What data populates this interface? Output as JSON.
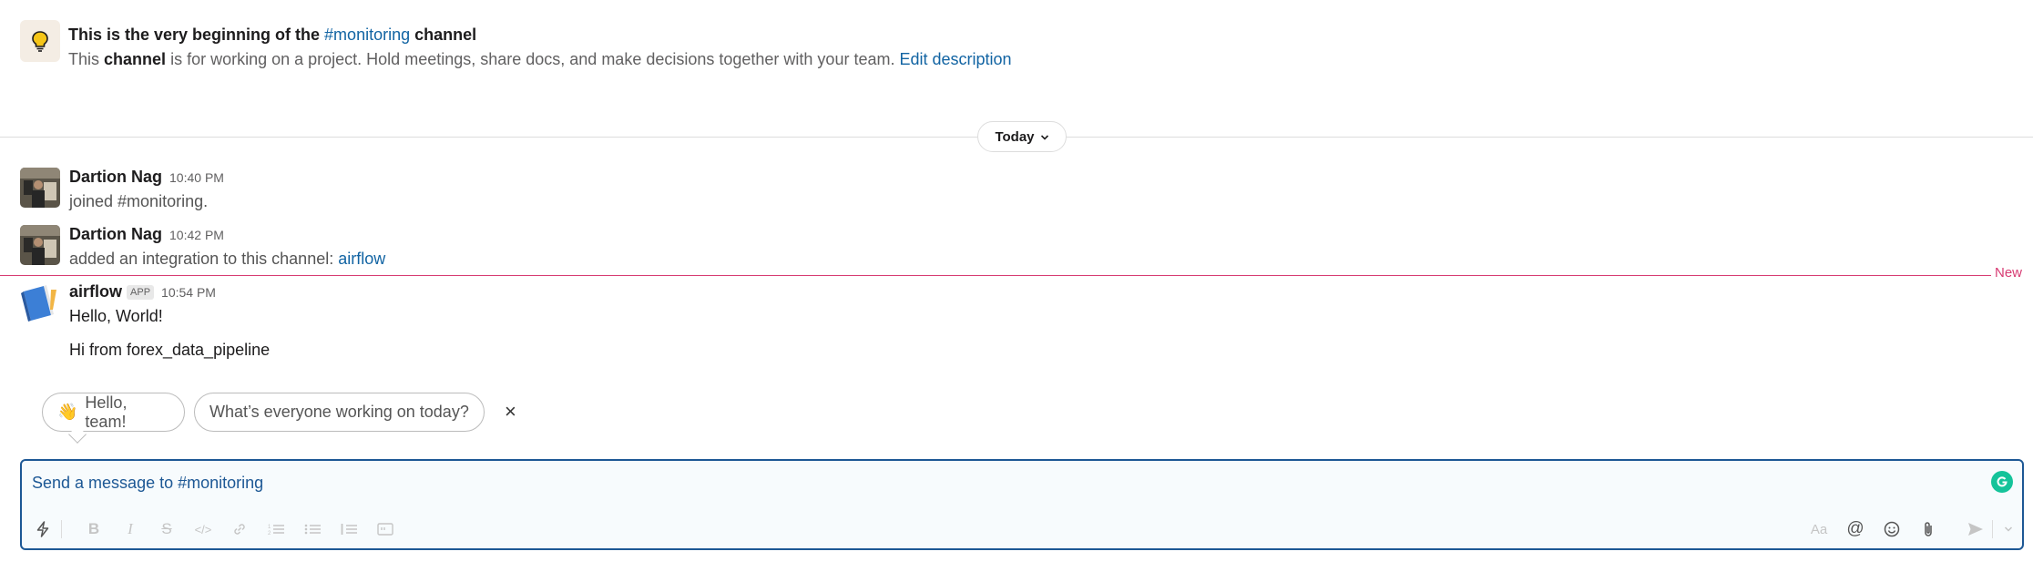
{
  "intro": {
    "title_prefix": "This is the very beginning of the",
    "channel": "#monitoring",
    "title_suffix": "channel",
    "desc_pre": "This",
    "desc_bold": "channel",
    "desc_post": "is for working on a project. Hold meetings, share docs, and make decisions together with your team.",
    "edit_link": "Edit description"
  },
  "divider": {
    "label": "Today"
  },
  "messages": [
    {
      "author": "Dartion Nag",
      "time": "10:40 PM",
      "text": "joined #monitoring."
    },
    {
      "author": "Dartion Nag",
      "time": "10:42 PM",
      "text": "added an integration to this channel:",
      "link": "airflow"
    },
    {
      "author": "airflow",
      "badge": "APP",
      "time": "10:54 PM",
      "lines": [
        "Hello, World!",
        "Hi from forex_data_pipeline"
      ]
    }
  ],
  "new_marker": "New",
  "suggestions": {
    "emoji": "👋",
    "first": "Hello, team!",
    "second": "What’s everyone working on today?",
    "dismiss": "×"
  },
  "composer": {
    "placeholder": "Send a message to #monitoring",
    "icons": [
      "shortcuts-icon",
      "bold-icon",
      "italic-icon",
      "strike-icon",
      "code-icon",
      "link-icon",
      "ordered-list-icon",
      "bullet-list-icon",
      "quote-icon",
      "code-block-icon",
      "format-icon",
      "mention-icon",
      "emoji-icon",
      "attach-icon",
      "send-icon",
      "send-options-icon"
    ]
  },
  "colors": {
    "link": "#1264a3",
    "new": "#d73c73",
    "composer_border": "#1d5895",
    "grammarly": "#15c39a"
  }
}
